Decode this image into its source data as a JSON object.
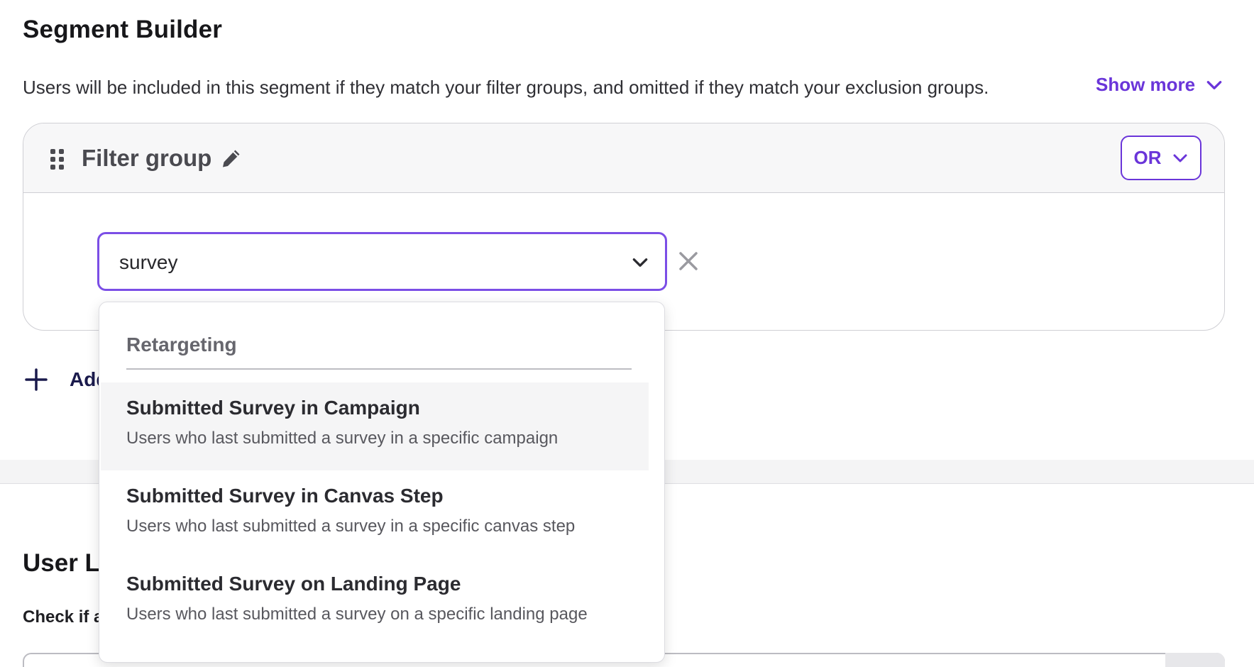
{
  "page": {
    "title": "Segment Builder",
    "description": "Users will be included in this segment if they match your filter groups, and omitted if they match your exclusion groups.",
    "show_more_label": "Show more"
  },
  "filter_group": {
    "title": "Filter group",
    "operator_label": "OR",
    "search_value": "survey"
  },
  "add_group": {
    "label": "Add"
  },
  "dropdown": {
    "group_label": "Retargeting",
    "options": [
      {
        "title": "Submitted Survey in Campaign",
        "description": "Users who last submitted a survey in a specific campaign"
      },
      {
        "title": "Submitted Survey in Canvas Step",
        "description": "Users who last submitted a survey in a specific canvas step"
      },
      {
        "title": "Submitted Survey on Landing Page",
        "description": "Users who last submitted a survey on a specific landing page"
      }
    ]
  },
  "user_lookup": {
    "title": "User L",
    "subtitle": "Check if a"
  },
  "colors": {
    "accent": "#6a35d9",
    "focus_border": "#7b4ee6",
    "header_bg": "#f7f7f8",
    "border": "#cfcfd4"
  },
  "icons": [
    "chevron-down-icon",
    "drag-handle-icon",
    "pencil-icon",
    "close-icon",
    "plus-icon"
  ]
}
